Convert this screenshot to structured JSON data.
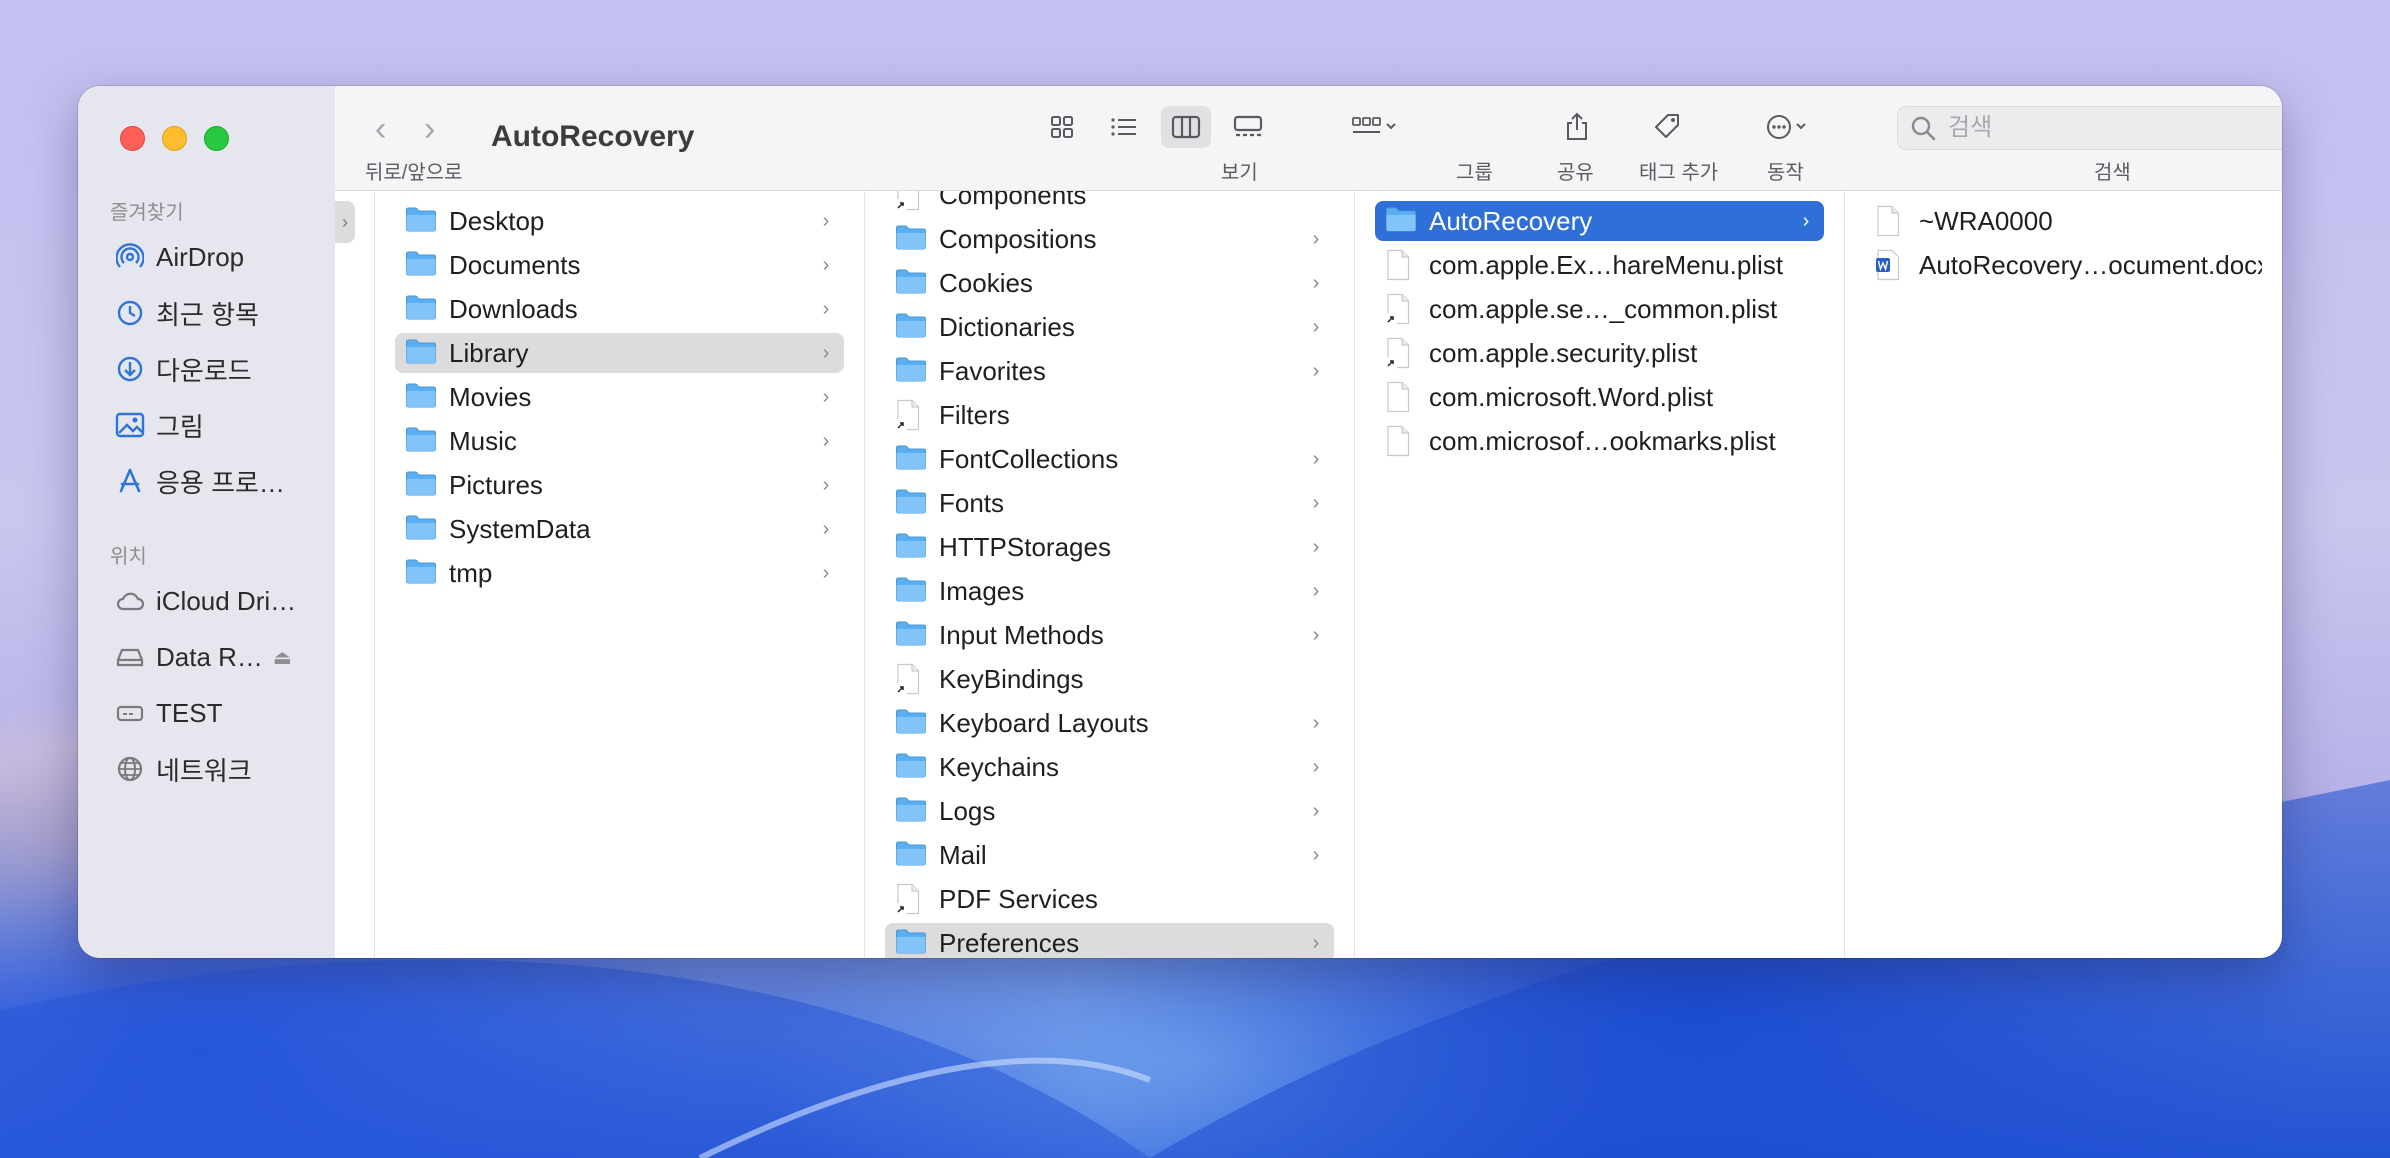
{
  "window": {
    "title": "AutoRecovery",
    "nav_caption": "뒤로/앞으로"
  },
  "toolbar": {
    "view_caption": "보기",
    "group_caption": "그룹",
    "share_caption": "공유",
    "tag_caption": "태그 추가",
    "action_caption": "동작",
    "search_caption": "검색",
    "search_placeholder": "검색"
  },
  "sidebar": {
    "favorites_label": "즐겨찾기",
    "favorites": [
      {
        "label": "AirDrop",
        "icon": "airdrop-icon"
      },
      {
        "label": "최근 항목",
        "icon": "clock-icon"
      },
      {
        "label": "다운로드",
        "icon": "download-icon"
      },
      {
        "label": "그림",
        "icon": "photo-icon"
      },
      {
        "label": "응용 프로…",
        "icon": "apps-icon"
      }
    ],
    "locations_label": "위치",
    "locations": [
      {
        "label": "iCloud Dri…",
        "icon": "cloud-icon"
      },
      {
        "label": "Data R…",
        "icon": "disk-icon"
      },
      {
        "label": "TEST",
        "icon": "disk-icon"
      },
      {
        "label": "네트워크",
        "icon": "globe-icon"
      }
    ]
  },
  "columns": {
    "col1": [
      {
        "name": "Desktop",
        "folder": true,
        "selected": false
      },
      {
        "name": "Documents",
        "folder": true,
        "selected": false
      },
      {
        "name": "Downloads",
        "folder": true,
        "selected": false
      },
      {
        "name": "Library",
        "folder": true,
        "selected": true
      },
      {
        "name": "Movies",
        "folder": true,
        "selected": false
      },
      {
        "name": "Music",
        "folder": true,
        "selected": false
      },
      {
        "name": "Pictures",
        "folder": true,
        "selected": false
      },
      {
        "name": "SystemData",
        "folder": true,
        "selected": false
      },
      {
        "name": "tmp",
        "folder": true,
        "selected": false
      }
    ],
    "col2": [
      {
        "name": "Components",
        "folder": false,
        "alias": true
      },
      {
        "name": "Compositions",
        "folder": true
      },
      {
        "name": "Cookies",
        "folder": true
      },
      {
        "name": "Dictionaries",
        "folder": true
      },
      {
        "name": "Favorites",
        "folder": true
      },
      {
        "name": "Filters",
        "folder": false,
        "alias": true
      },
      {
        "name": "FontCollections",
        "folder": true
      },
      {
        "name": "Fonts",
        "folder": true
      },
      {
        "name": "HTTPStorages",
        "folder": true
      },
      {
        "name": "Images",
        "folder": true
      },
      {
        "name": "Input Methods",
        "folder": true
      },
      {
        "name": "KeyBindings",
        "folder": false,
        "alias": true
      },
      {
        "name": "Keyboard Layouts",
        "folder": true
      },
      {
        "name": "Keychains",
        "folder": true
      },
      {
        "name": "Logs",
        "folder": true
      },
      {
        "name": "Mail",
        "folder": true
      },
      {
        "name": "PDF Services",
        "folder": false,
        "alias": true
      },
      {
        "name": "Preferences",
        "folder": true,
        "selected": true
      }
    ],
    "col3": [
      {
        "name": "AutoRecovery",
        "folder": true,
        "selected": true
      },
      {
        "name": "com.apple.Ex…hareMenu.plist",
        "folder": false
      },
      {
        "name": "com.apple.se…_common.plist",
        "folder": false,
        "alias": true
      },
      {
        "name": "com.apple.security.plist",
        "folder": false,
        "alias": true
      },
      {
        "name": "com.microsoft.Word.plist",
        "folder": false
      },
      {
        "name": "com.microsof…ookmarks.plist",
        "folder": false
      }
    ],
    "col4": [
      {
        "name": "~WRA0000",
        "type": "file"
      },
      {
        "name": "AutoRecovery…ocument.docx",
        "type": "word"
      }
    ]
  }
}
